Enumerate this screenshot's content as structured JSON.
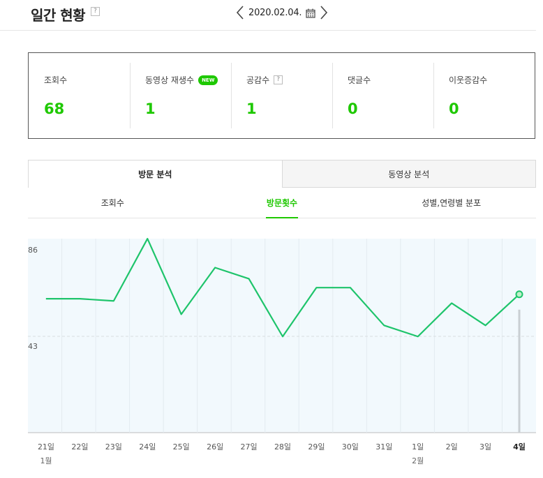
{
  "header": {
    "title": "일간 현황",
    "help": "?",
    "date": "2020.02.04."
  },
  "stats": [
    {
      "label": "조회수",
      "value": "68"
    },
    {
      "label": "동영상 재생수",
      "value": "1",
      "badge": "NEW"
    },
    {
      "label": "공감수",
      "value": "1",
      "help": "?"
    },
    {
      "label": "댓글수",
      "value": "0"
    },
    {
      "label": "이웃증감수",
      "value": "0"
    }
  ],
  "main_tabs": [
    "방문 분석",
    "동영상 분석"
  ],
  "sub_tabs": [
    "조회수",
    "방문횟수",
    "성별,연령별 분포"
  ],
  "colors": {
    "accent": "#1ec800",
    "line": "#1ec46b",
    "plot_bg": "#f2f9fd"
  },
  "icons": {
    "prev": "chevron-left-icon",
    "next": "chevron-right-icon",
    "calendar": "calendar-icon"
  },
  "chart_data": {
    "type": "line",
    "categories": [
      "21일",
      "22일",
      "23일",
      "24일",
      "25일",
      "26일",
      "27일",
      "28일",
      "29일",
      "30일",
      "31일",
      "1일",
      "2일",
      "3일",
      "4일"
    ],
    "month_labels": [
      {
        "index": 0,
        "label": "1월"
      },
      {
        "index": 11,
        "label": "2월"
      }
    ],
    "values": [
      64,
      64,
      63,
      91,
      57,
      78,
      73,
      47,
      69,
      69,
      52,
      47,
      62,
      52,
      66
    ],
    "y_ticks": [
      "86",
      "43"
    ],
    "ylim": [
      0,
      86
    ],
    "highlight_index": 14,
    "grid": "vertical lines per day, dashed line at 43"
  }
}
